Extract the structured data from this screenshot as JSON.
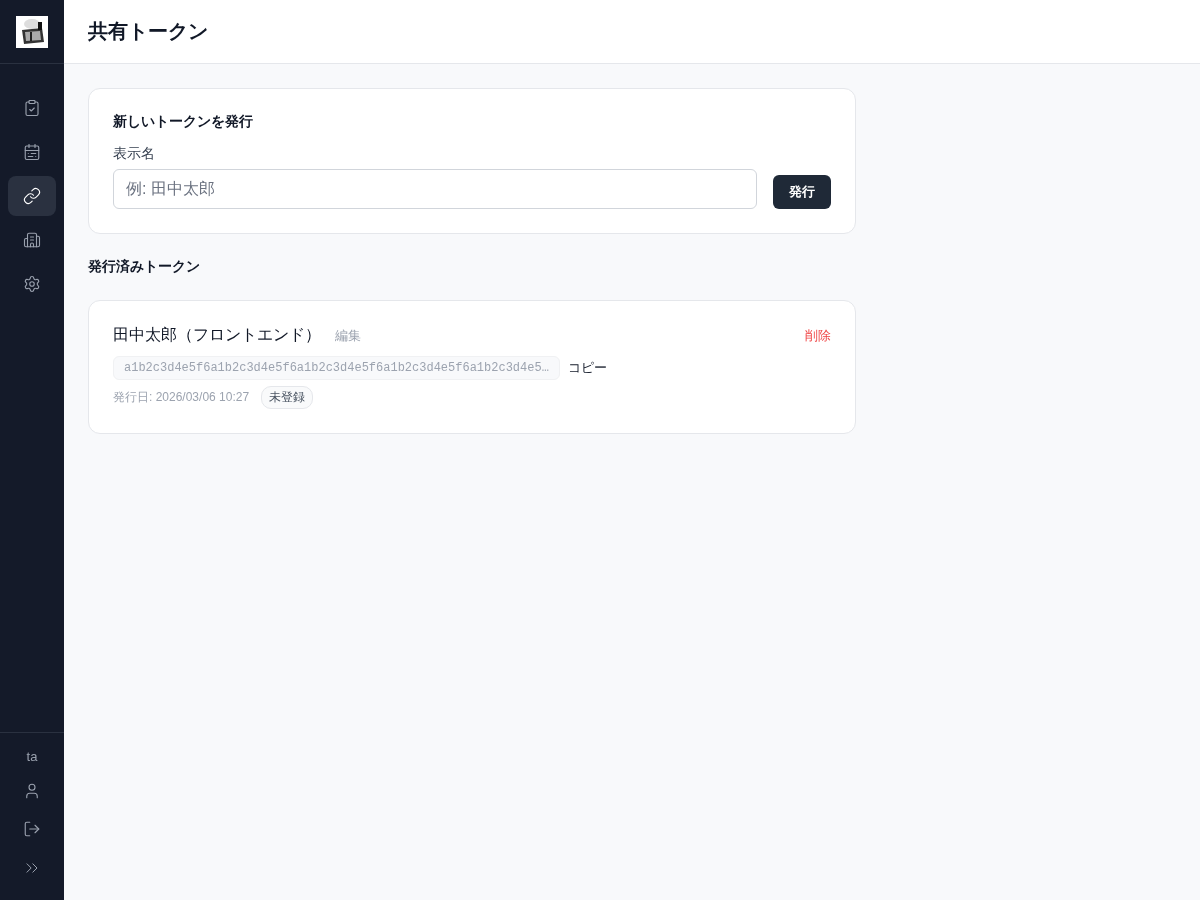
{
  "sidebar": {
    "nav": [
      {
        "selected": false
      },
      {
        "selected": false
      },
      {
        "selected": true
      },
      {
        "selected": false
      },
      {
        "selected": false
      }
    ],
    "user": "ta"
  },
  "header": {
    "title": "共有トークン"
  },
  "issue_card": {
    "title": "新しいトークンを発行",
    "label": "表示名",
    "placeholder": "例: 田中太郎",
    "button": "発行"
  },
  "issued_heading": "発行済みトークン",
  "tokens": [
    {
      "name": "田中太郎（フロントエンド）",
      "edit": "編集",
      "delete": "削除",
      "token": "a1b2c3d4e5f6a1b2c3d4e5f6a1b2c3d4e5f6a1b2c3d4e5f6a1b2c3d4e5…",
      "copy": "コピー",
      "issued": "発行日: 2026/03/06 10:27",
      "status": "未登録"
    }
  ]
}
